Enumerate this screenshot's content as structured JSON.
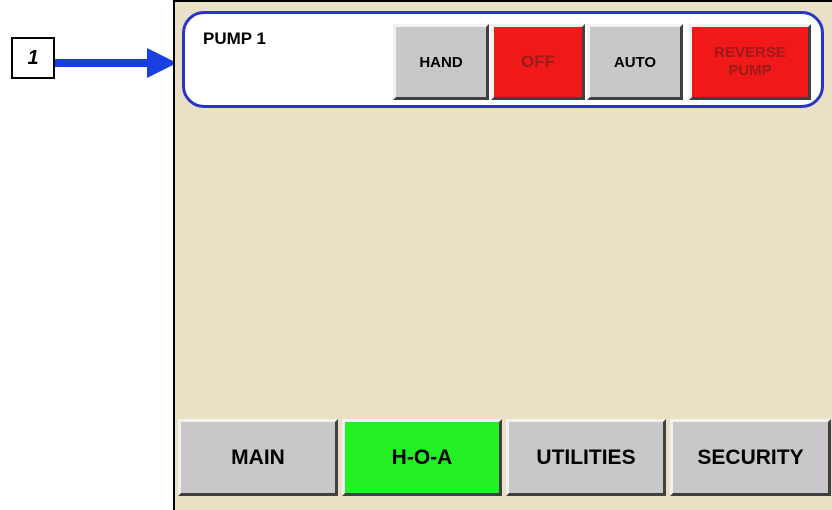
{
  "callout": {
    "number": "1"
  },
  "pump": {
    "title": "PUMP 1",
    "buttons": {
      "hand": "HAND",
      "off": "OFF",
      "auto": "AUTO",
      "reverse": "REVERSE\nPUMP"
    }
  },
  "nav": {
    "main": "MAIN",
    "hoa": "H-O-A",
    "utilities": "UTILITIES",
    "security": "SECURITY"
  },
  "colors": {
    "panel_background": "#e9e0c5",
    "group_border": "#2a33c8",
    "off_red": "#f01818",
    "active_green": "#22f022",
    "arrow_blue": "#1a3fe0",
    "button_grey": "#c9c7c7"
  },
  "icons": {
    "callout_arrow": "arrow-right-icon"
  }
}
